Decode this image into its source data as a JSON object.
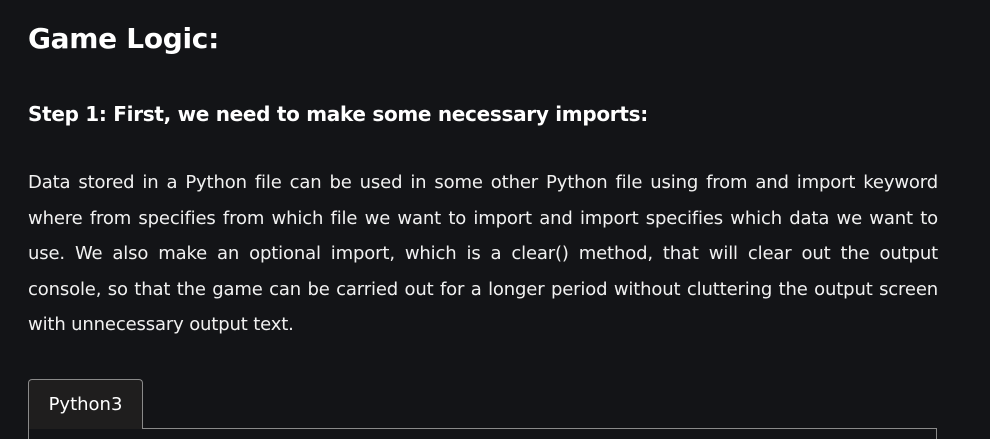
{
  "article": {
    "section_title": "Game Logic:",
    "step_title": "Step 1: First, we need to make some necessary imports:",
    "paragraph": "Data stored in a Python file can be used in some other Python file using from and import keyword where from specifies from which file we want to import and import specifies which data we want to use. We also make an optional import, which is a clear() method, that will clear out the output console, so that the game can be carried out for a longer period without cluttering the output screen with unnecessary output text."
  },
  "code_block": {
    "tabs": [
      {
        "label": "Python3",
        "active": true
      }
    ]
  },
  "colors": {
    "background": "#131417",
    "text": "#ffffff",
    "tab_background": "#1f1e1e",
    "border": "#8a8a8a"
  }
}
